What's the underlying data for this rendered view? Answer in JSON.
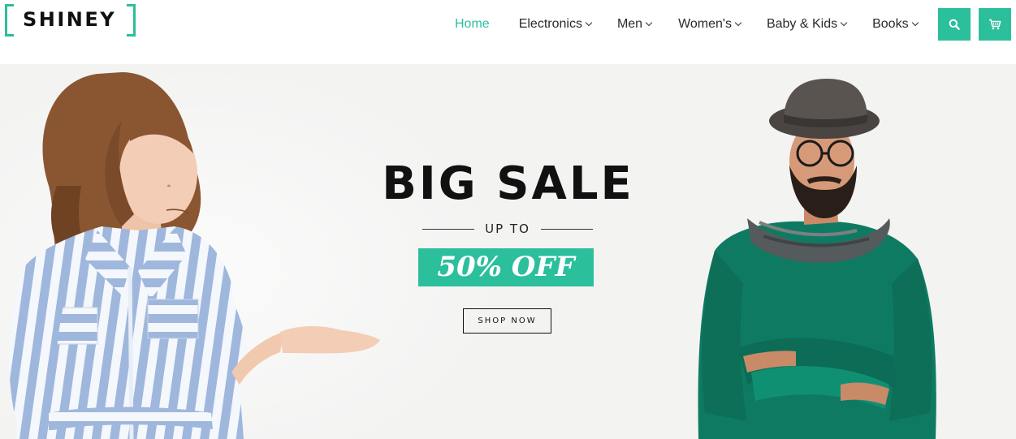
{
  "brand": {
    "name": "SHINEY",
    "accent": "#2bbf9c"
  },
  "nav": {
    "items": [
      {
        "label": "Home",
        "active": true,
        "dropdown": false
      },
      {
        "label": "Electronics",
        "active": false,
        "dropdown": true
      },
      {
        "label": "Men",
        "active": false,
        "dropdown": true
      },
      {
        "label": "Women's",
        "active": false,
        "dropdown": true
      },
      {
        "label": "Baby & Kids",
        "active": false,
        "dropdown": true
      },
      {
        "label": "Books",
        "active": false,
        "dropdown": true
      }
    ],
    "icons": {
      "search": "search-icon",
      "cart": "cart-icon"
    }
  },
  "hero": {
    "headline": "BIG SALE",
    "subline": "UP TO",
    "offer": "50% OFF",
    "cta": "SHOP NOW"
  }
}
